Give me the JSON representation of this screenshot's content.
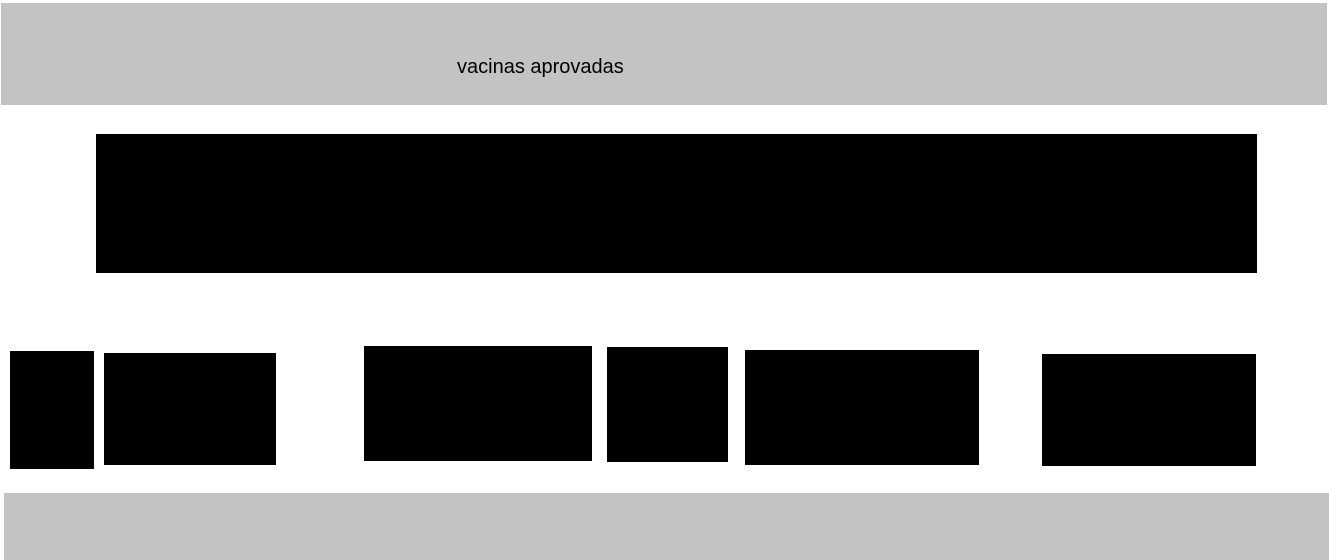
{
  "header": {
    "title": "vacinas aprovadas"
  },
  "colors": {
    "header_background": "#c3c3c3",
    "footer_background": "#c3c3c3",
    "content_block": "#000000",
    "page_background": "#ffffff",
    "text": "#000000"
  }
}
